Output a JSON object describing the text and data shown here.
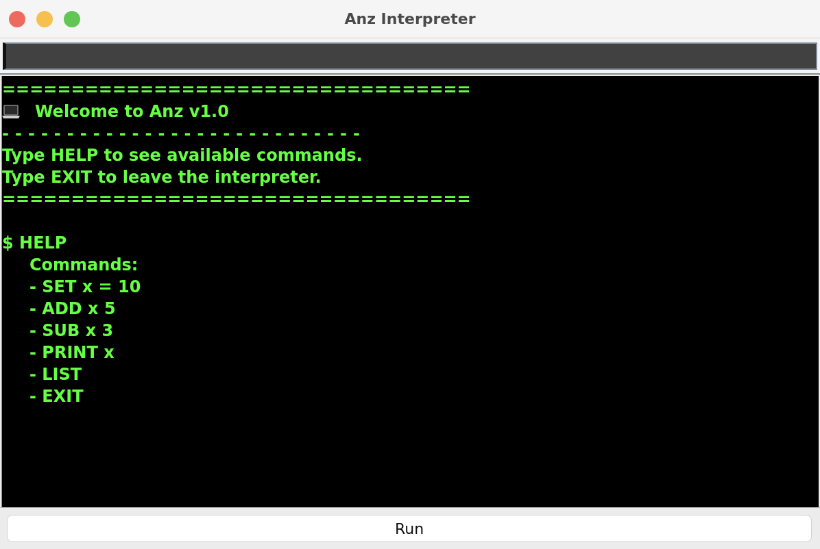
{
  "window": {
    "title": "Anz Interpreter"
  },
  "console": [
    {
      "kind": "rule",
      "text": "=================================="
    },
    {
      "kind": "banner",
      "text": "Welcome to Anz v1.0"
    },
    {
      "kind": "dash_rule",
      "text": "----------------------------"
    },
    {
      "kind": "text",
      "text": "Type HELP to see available commands."
    },
    {
      "kind": "text",
      "text": "Type EXIT to leave the interpreter."
    },
    {
      "kind": "rule",
      "text": "=================================="
    },
    {
      "kind": "blank"
    },
    {
      "kind": "prompt",
      "text": "$ HELP"
    },
    {
      "kind": "output",
      "text": "Commands:"
    },
    {
      "kind": "item",
      "text": "- SET x = 10"
    },
    {
      "kind": "item",
      "text": "- ADD x 5"
    },
    {
      "kind": "item",
      "text": "- SUB x 3"
    },
    {
      "kind": "item",
      "text": "- PRINT x"
    },
    {
      "kind": "item",
      "text": "- LIST"
    },
    {
      "kind": "item",
      "text": "- EXIT"
    }
  ],
  "run_button": {
    "label": "Run"
  }
}
